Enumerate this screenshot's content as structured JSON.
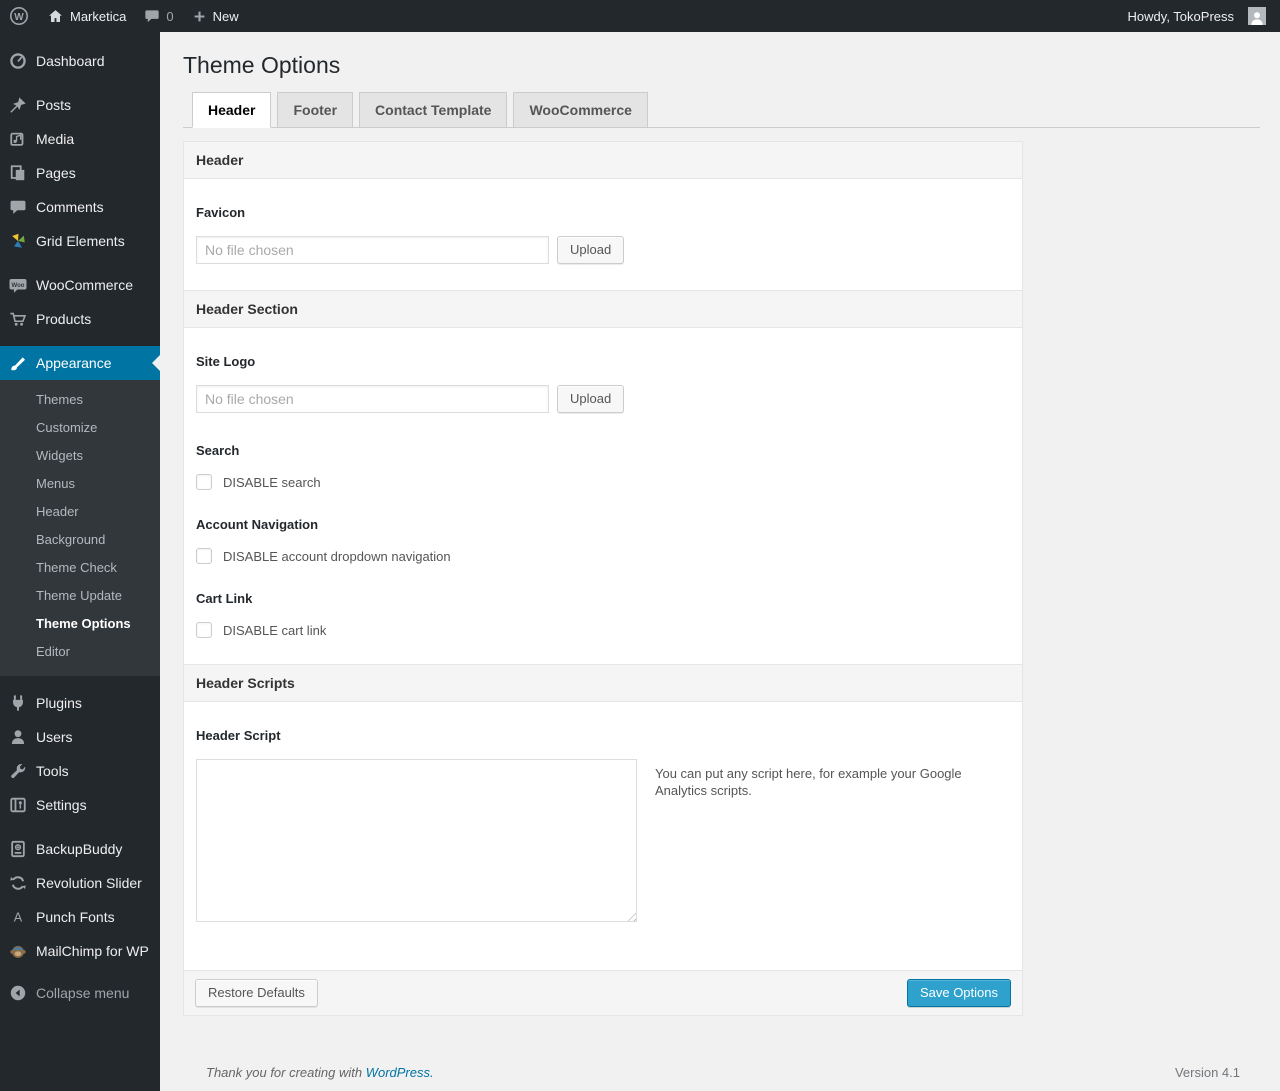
{
  "admin_bar": {
    "site_name": "Marketica",
    "comment_count": "0",
    "new_label": "New",
    "howdy_text": "Howdy, TokoPress",
    "wp_logo_letter": "W"
  },
  "sidebar": {
    "items": [
      {
        "label": "Dashboard"
      },
      {
        "label": "Posts"
      },
      {
        "label": "Media"
      },
      {
        "label": "Pages"
      },
      {
        "label": "Comments"
      },
      {
        "label": "Grid Elements"
      },
      {
        "label": "WooCommerce"
      },
      {
        "label": "Products"
      },
      {
        "label": "Appearance"
      },
      {
        "label": "Plugins"
      },
      {
        "label": "Users"
      },
      {
        "label": "Tools"
      },
      {
        "label": "Settings"
      },
      {
        "label": "BackupBuddy"
      },
      {
        "label": "Revolution Slider"
      },
      {
        "label": "Punch Fonts"
      },
      {
        "label": "MailChimp for WP"
      },
      {
        "label": "Collapse menu"
      }
    ],
    "active_item": "Appearance",
    "appearance_submenu": [
      "Themes",
      "Customize",
      "Widgets",
      "Menus",
      "Header",
      "Background",
      "Theme Check",
      "Theme Update",
      "Theme Options",
      "Editor"
    ],
    "active_submenu_item": "Theme Options",
    "icons": {
      "woo_badge_text": "Woo",
      "punch_fonts_letter": "A"
    }
  },
  "page": {
    "title": "Theme Options",
    "tabs": [
      {
        "label": "Header",
        "active": true
      },
      {
        "label": "Footer",
        "active": false
      },
      {
        "label": "Contact Template",
        "active": false
      },
      {
        "label": "WooCommerce",
        "active": false
      }
    ],
    "panel": {
      "section_bars": [
        "Header",
        "Header Section",
        "Header Scripts"
      ],
      "favicon": {
        "label": "Favicon",
        "file_placeholder": "No file chosen",
        "upload_label": "Upload"
      },
      "site_logo": {
        "label": "Site Logo",
        "file_placeholder": "No file chosen",
        "upload_label": "Upload"
      },
      "search": {
        "label": "Search",
        "checkbox_label": "DISABLE search",
        "checked": false
      },
      "account_navigation": {
        "label": "Account Navigation",
        "checkbox_label": "DISABLE account dropdown navigation",
        "checked": false
      },
      "cart_link": {
        "label": "Cart Link",
        "checkbox_label": "DISABLE cart link",
        "checked": false
      },
      "header_script": {
        "label": "Header Script",
        "value": "",
        "help_text": "You can put any script here, for example your Google Analytics scripts."
      },
      "actions": {
        "restore_label": "Restore Defaults",
        "save_label": "Save Options"
      }
    },
    "footer": {
      "thanks_prefix": "Thank you for creating with ",
      "wordpress_link": "WordPress.",
      "version": "Version 4.1"
    }
  },
  "colors": {
    "admin_bar_bg": "#23282d",
    "submenu_bg": "#32373c",
    "menu_highlight": "#0074a2",
    "primary_button": "#2ea2cc",
    "page_bg": "#f1f1f1"
  }
}
